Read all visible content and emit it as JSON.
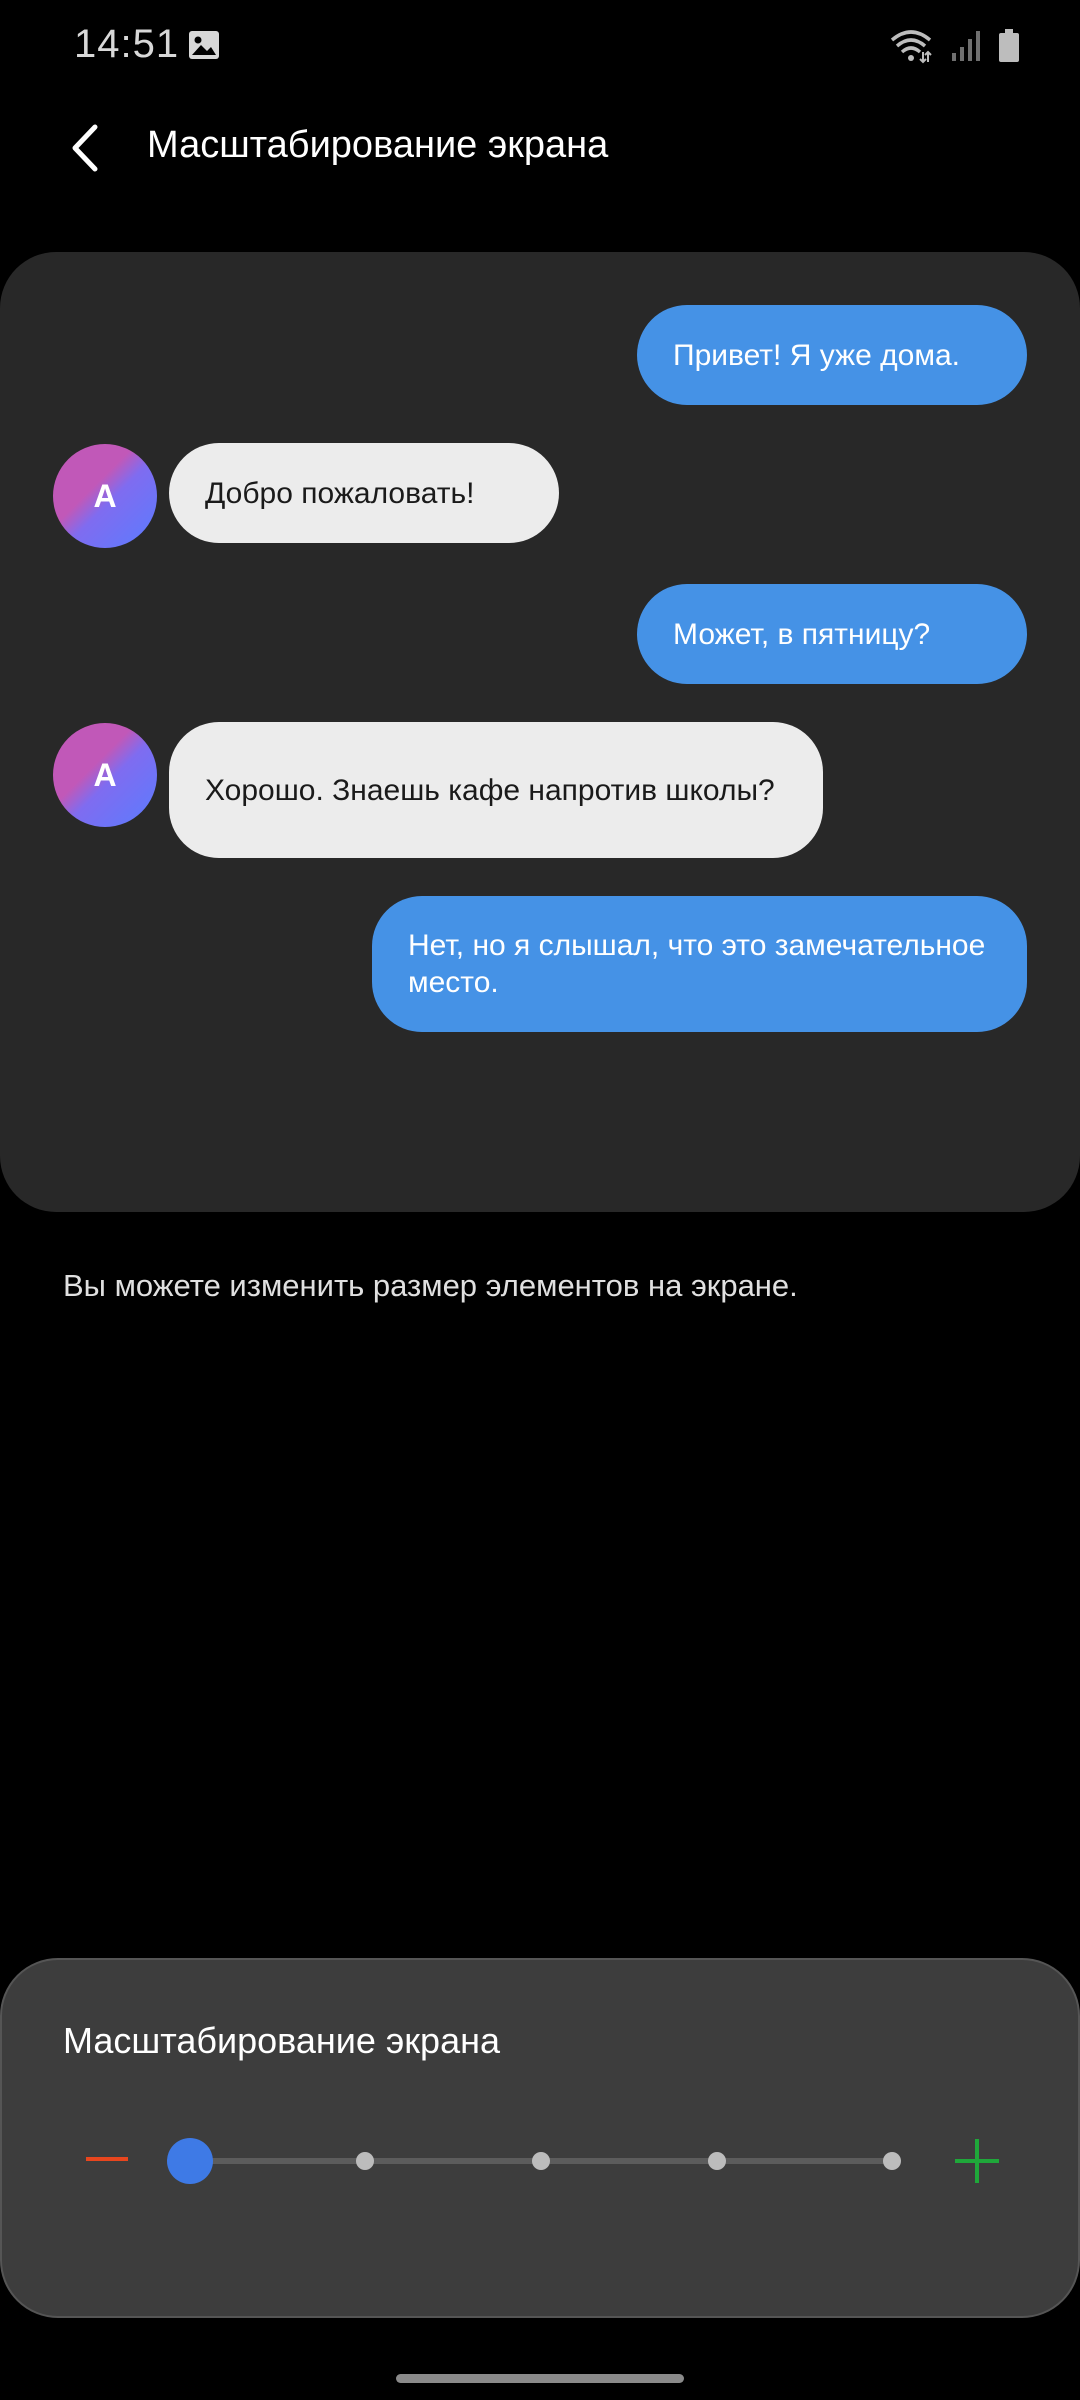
{
  "status_bar": {
    "time": "14:51",
    "icons": [
      "gallery-icon",
      "wifi-icon",
      "signal-icon",
      "battery-icon"
    ]
  },
  "header": {
    "title": "Масштабирование экрана",
    "back_icon": "back-arrow-icon"
  },
  "preview": {
    "messages": [
      {
        "direction": "out",
        "text": "Привет! Я уже дома."
      },
      {
        "direction": "in",
        "avatar": "A",
        "text": "Добро пожаловать!"
      },
      {
        "direction": "out",
        "text": "Может, в пятницу?"
      },
      {
        "direction": "in",
        "avatar": "A",
        "text": "Хорошо. Знаешь кафе напротив школы?"
      },
      {
        "direction": "out",
        "text": "Нет, но я слышал, что это замечательное место."
      }
    ]
  },
  "description": "Вы можете изменить размер элементов на экране.",
  "zoom_panel": {
    "title": "Масштабирование экрана",
    "minus_icon": "minus-icon",
    "plus_icon": "plus-icon",
    "levels": 5,
    "selected_level": 1
  },
  "colors": {
    "accent": "#3e7ae6",
    "bubble_out": "#4592e6",
    "bubble_in": "#ececec",
    "minus": "#e8461e",
    "plus": "#1fa83a"
  }
}
